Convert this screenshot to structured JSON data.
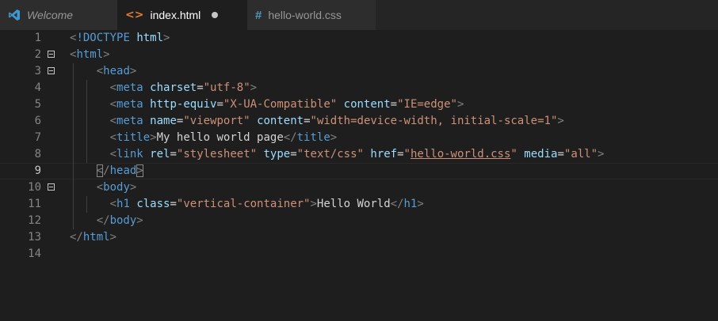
{
  "tabs": {
    "welcome": {
      "label": "Welcome",
      "icon": "vscode-logo-icon"
    },
    "index": {
      "label": "index.html",
      "icon": "html-file-icon",
      "icon_glyph": "<>",
      "dirty": true
    },
    "css": {
      "label": "hello-world.css",
      "icon": "css-file-icon",
      "icon_glyph": "#"
    }
  },
  "colors": {
    "background": "#1e1e1e",
    "tag": "#569cd6",
    "attribute": "#9cdcfe",
    "string": "#ce9178",
    "punctuation": "#808080",
    "text": "#d4d4d4",
    "line_number": "#858585"
  },
  "editor": {
    "current_line": 9,
    "foldable_lines": [
      2,
      3,
      10
    ],
    "lines": [
      {
        "n": "1"
      },
      {
        "n": "2"
      },
      {
        "n": "3"
      },
      {
        "n": "4"
      },
      {
        "n": "5"
      },
      {
        "n": "6"
      },
      {
        "n": "7"
      },
      {
        "n": "8"
      },
      {
        "n": "9"
      },
      {
        "n": "10"
      },
      {
        "n": "11"
      },
      {
        "n": "12"
      },
      {
        "n": "13"
      },
      {
        "n": "14"
      }
    ]
  },
  "code": {
    "l1": {
      "lt": "<",
      "doctype": "!DOCTYPE",
      "html": "html",
      "gt": ">"
    },
    "l2": {
      "lt": "<",
      "tag": "html",
      "gt": ">"
    },
    "l3": {
      "lt": "<",
      "tag": "head",
      "gt": ">"
    },
    "l4": {
      "lt": "<",
      "tag": "meta",
      "a1": "charset",
      "eq1": "=",
      "v1": "\"utf-8\"",
      "gt": ">"
    },
    "l5": {
      "lt": "<",
      "tag": "meta",
      "a1": "http-equiv",
      "eq1": "=",
      "v1": "\"X-UA-Compatible\"",
      "a2": "content",
      "eq2": "=",
      "v2": "\"IE=edge\"",
      "gt": ">"
    },
    "l6": {
      "lt": "<",
      "tag": "meta",
      "a1": "name",
      "eq1": "=",
      "v1": "\"viewport\"",
      "a2": "content",
      "eq2": "=",
      "v2": "\"width=device-width, initial-scale=1\"",
      "gt": ">"
    },
    "l7": {
      "lt": "<",
      "tag": "title",
      "gt": ">",
      "text": "My hello world page",
      "lt2": "</",
      "tag2": "title",
      "gt2": ">"
    },
    "l8": {
      "lt": "<",
      "tag": "link",
      "a1": "rel",
      "eq1": "=",
      "v1": "\"stylesheet\"",
      "a2": "type",
      "eq2": "=",
      "v2": "\"text/css\"",
      "a3": "href",
      "eq3": "=",
      "q3a": "\"",
      "v3": "hello-world.css",
      "q3b": "\"",
      "a4": "media",
      "eq4": "=",
      "v4": "\"all\"",
      "gt": ">"
    },
    "l9": {
      "lt": "<",
      "slash": "/",
      "tag": "head",
      "gt": ">"
    },
    "l10": {
      "lt": "<",
      "tag": "body",
      "gt": ">"
    },
    "l11": {
      "lt": "<",
      "tag": "h1",
      "a1": "class",
      "eq1": "=",
      "v1": "\"vertical-container\"",
      "gt": ">",
      "text": "Hello World",
      "lt2": "</",
      "tag2": "h1",
      "gt2": ">"
    },
    "l12": {
      "lt": "</",
      "tag": "body",
      "gt": ">"
    },
    "l13": {
      "lt": "</",
      "tag": "html",
      "gt": ">"
    }
  }
}
